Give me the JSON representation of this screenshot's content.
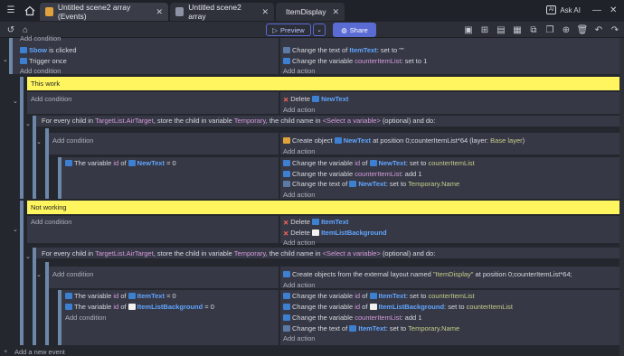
{
  "tabs": [
    {
      "label": "Untitled scene2 array (Events)",
      "active": true
    },
    {
      "label": "Untitled scene2 array",
      "active": false
    },
    {
      "label": "ItemDisplay",
      "active": false
    }
  ],
  "ask_ai": "Ask AI",
  "toolbar": {
    "preview": "Preview",
    "share": "Share"
  },
  "events": {
    "top": {
      "add_condition_cut": "Add condition",
      "cond1_obj": "Sbow",
      "cond1_rest": "is clicked",
      "cond2": "Trigger once",
      "add_condition": "Add condition",
      "act1_pre": "Change the text of",
      "act1_obj": "ItemText",
      "act1_rest": ": set to \"\"",
      "act2_pre": "Change the variable",
      "act2_var": "counterItemList",
      "act2_rest": ": set to 1",
      "add_action": "Add action"
    },
    "comment1": "This work",
    "g1": {
      "add_condition": "Add condition",
      "delete_pre": "Delete",
      "delete_obj": "NewText",
      "add_action": "Add action",
      "foreach_a": "For every child in",
      "foreach_var": "TargetList.AirTarget",
      "foreach_b": ", store the child in variable",
      "foreach_store": "Temporary",
      "foreach_c": ", the child name in",
      "foreach_sel": "<Select a variable>",
      "foreach_d": "(optional) and do:",
      "add_condition2": "Add condition",
      "create_pre": "Create object",
      "create_obj": "NewText",
      "create_rest": "at position 0;counterItemList*64 (layer:",
      "create_layer": "Base layer",
      "create_end": ")",
      "add_action2": "Add action",
      "cond_pre": "The variable",
      "cond_var": "id",
      "cond_of": "of",
      "cond_obj": "NewText",
      "cond_rest": "= 0",
      "a1_pre": "Change the variable",
      "a1_var": "id",
      "a1_of": "of",
      "a1_obj": "NewText",
      "a1_rest": ": set to",
      "a1_val": "counterItemList",
      "a2_pre": "Change the variable",
      "a2_var": "counterItemList",
      "a2_rest": ": add 1",
      "a3_pre": "Change the text of",
      "a3_obj": "NewText",
      "a3_rest": ": set to",
      "a3_val": "Temporary.Name",
      "add_action3": "Add action"
    },
    "comment2": "Not working",
    "g2": {
      "add_condition": "Add condition",
      "delete1_pre": "Delete",
      "delete1_obj": "ItemText",
      "delete2_pre": "Delete",
      "delete2_obj": "ItemListBackground",
      "add_action": "Add action",
      "foreach_a": "For every child in",
      "foreach_var": "TargetList.AirTarget",
      "foreach_b": ", store the child in variable",
      "foreach_store": "Temporary",
      "foreach_c": ", the child name in",
      "foreach_sel": "<Select a variable>",
      "foreach_d": "(optional) and do:",
      "add_condition2": "Add condition",
      "create_text": "Create objects from the external layout named",
      "create_layout": "\"ItemDisplay\"",
      "create_rest": "at position 0;counterItemList*64;",
      "add_action2": "Add action",
      "c1_pre": "The variable",
      "c1_var": "id",
      "c1_of": "of",
      "c1_obj": "ItemText",
      "c1_rest": "= 0",
      "c2_pre": "The variable",
      "c2_var": "id",
      "c2_of": "of",
      "c2_obj": "ItemListBackground",
      "c2_rest": "= 0",
      "add_condition3": "Add condition",
      "a1_pre": "Change the variable",
      "a1_var": "id",
      "a1_of": "of",
      "a1_obj": "ItemText",
      "a1_rest": ": set to",
      "a1_val": "counterItemList",
      "a2_pre": "Change the variable",
      "a2_var": "id",
      "a2_of": "of",
      "a2_obj": "ItemListBackground",
      "a2_rest": ": set to",
      "a2_val": "counterItemList",
      "a3_pre": "Change the variable",
      "a3_var": "counterItemList",
      "a3_rest": ": add 1",
      "a4_pre": "Change the text of",
      "a4_obj": "ItemText",
      "a4_rest": ": set to",
      "a4_val": "Temporary.Name",
      "add_action3": "Add action"
    },
    "add_new_event": "Add a new event"
  },
  "colors": {
    "accent": "#5a6bd4",
    "comment": "#fff55f",
    "object": "#61a6ff",
    "variable": "#d59cdd",
    "value": "#c4d08a"
  }
}
